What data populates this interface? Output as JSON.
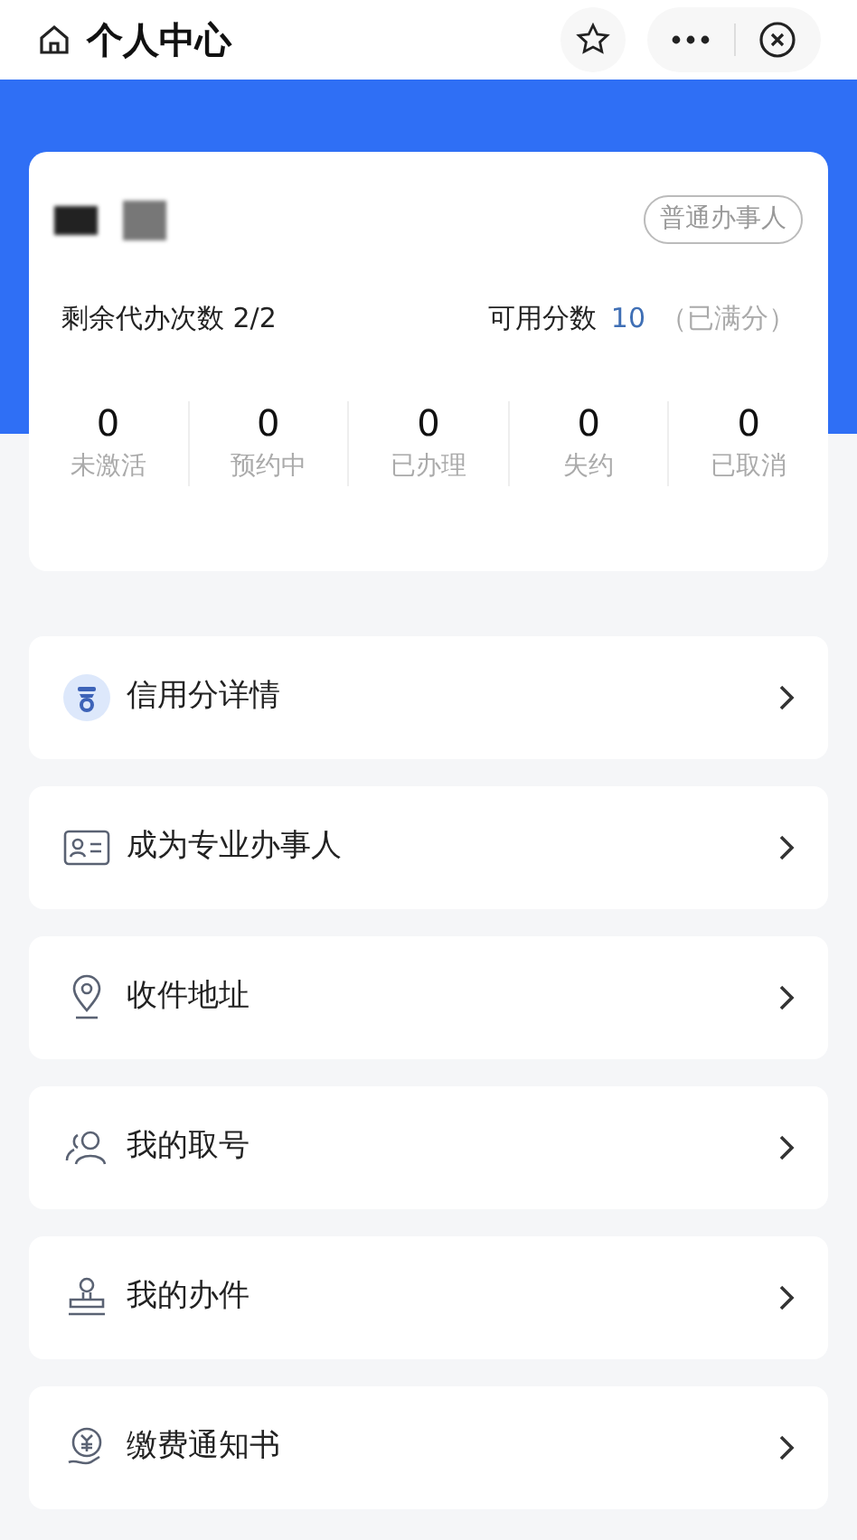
{
  "header": {
    "title": "个人中心"
  },
  "profile": {
    "badge": "普通办事人",
    "quota_label": "剩余代办次数 2/2",
    "score_label": "可用分数",
    "score_value": "10",
    "score_note": "（已满分）"
  },
  "stats": [
    {
      "count": "0",
      "label": "未激活"
    },
    {
      "count": "0",
      "label": "预约中"
    },
    {
      "count": "0",
      "label": "已办理"
    },
    {
      "count": "0",
      "label": "失约"
    },
    {
      "count": "0",
      "label": "已取消"
    }
  ],
  "menu": [
    {
      "label": "信用分详情"
    },
    {
      "label": "成为专业办事人"
    },
    {
      "label": "收件地址"
    },
    {
      "label": "我的取号"
    },
    {
      "label": "我的办件"
    },
    {
      "label": "缴费通知书"
    }
  ]
}
